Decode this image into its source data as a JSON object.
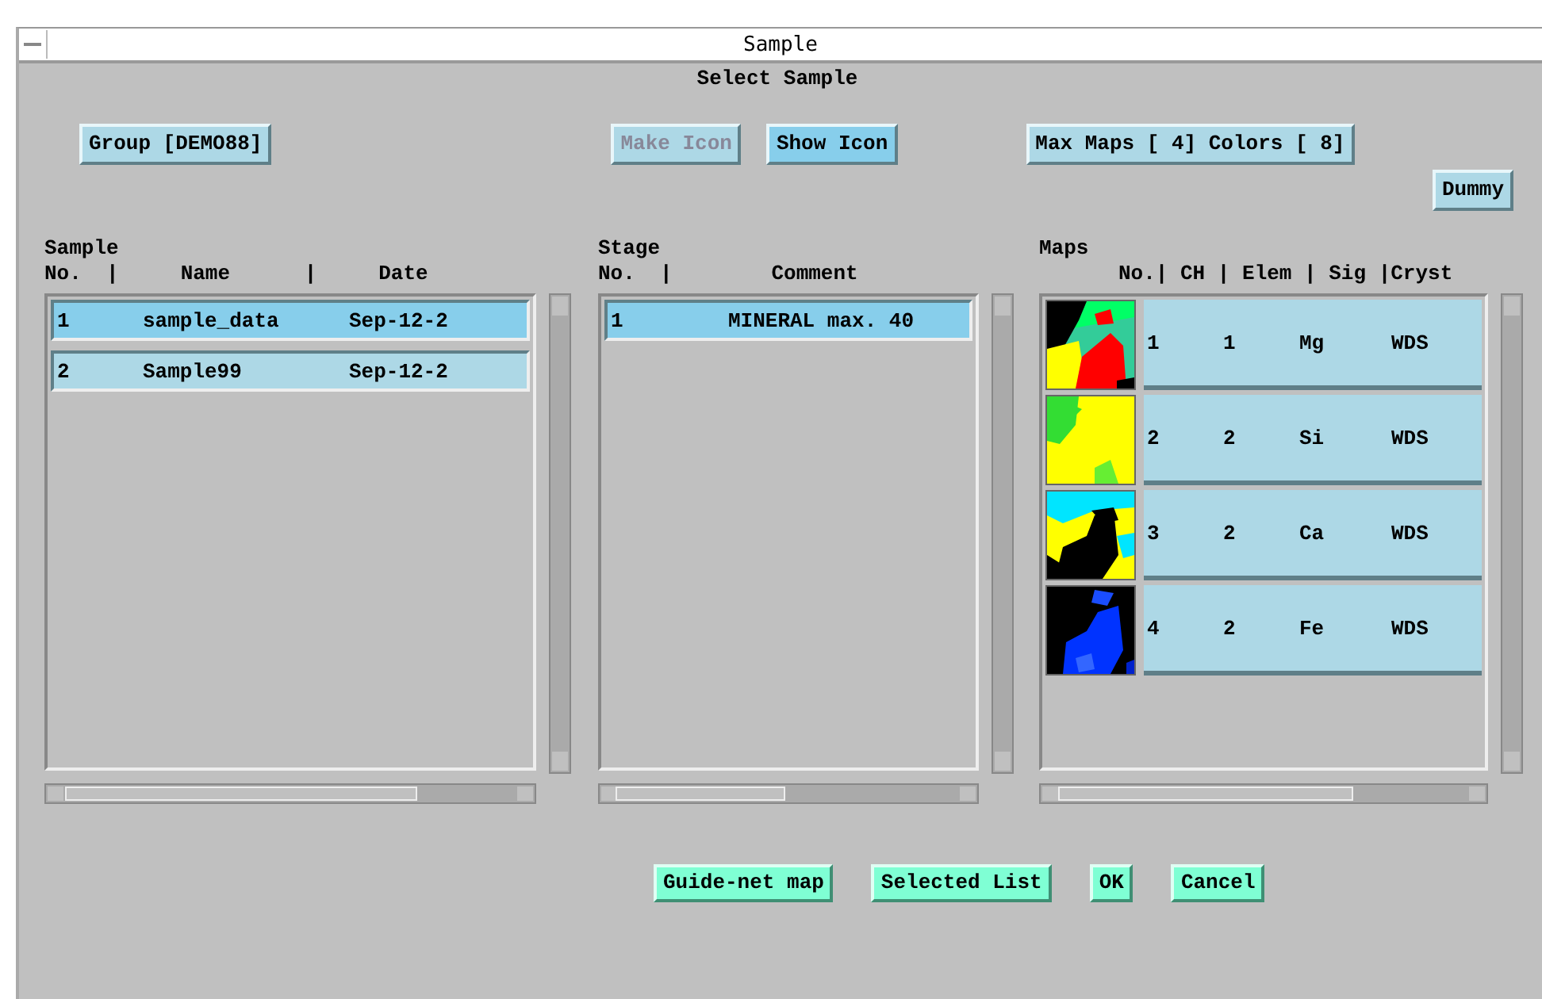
{
  "window": {
    "title": "Sample"
  },
  "heading": "Select Sample",
  "top_buttons": [
    {
      "label": "Group [DEMO88]",
      "disabled": false,
      "active": false
    },
    {
      "label": "Make Icon",
      "disabled": true,
      "active": false
    },
    {
      "label": "Show Icon",
      "disabled": false,
      "active": true
    },
    {
      "label": "Max Maps [ 4] Colors [ 8]",
      "disabled": false,
      "active": false
    }
  ],
  "dummy_button": "Dummy",
  "sample_panel": {
    "title": "Sample",
    "header": "No.  |     Name      |     Date",
    "rows": [
      {
        "no": "1",
        "name": "sample_data",
        "date": "Sep-12-2",
        "selected": true
      },
      {
        "no": "2",
        "name": "Sample99",
        "date": "Sep-12-2",
        "selected": false
      }
    ]
  },
  "stage_panel": {
    "title": "Stage",
    "header": "No.  |        Comment",
    "rows": [
      {
        "no": "1",
        "comment": "MINERAL max. 40",
        "selected": true
      }
    ]
  },
  "maps_panel": {
    "title": "Maps",
    "header": "No.| CH | Elem | Sig |Cryst",
    "rows": [
      {
        "no": "1",
        "ch": "1",
        "elem": "Mg",
        "sig": "WDS",
        "kind": "picture"
      },
      {
        "no": "2",
        "ch": "2",
        "elem": "Si",
        "sig": "WDS",
        "kind": "picture"
      },
      {
        "no": "3",
        "ch": "2",
        "elem": "Ca",
        "sig": "WDS",
        "kind": "picture"
      },
      {
        "no": "4",
        "ch": "2",
        "elem": "Fe",
        "sig": "WDS",
        "kind": "picture"
      }
    ]
  },
  "bottom_buttons": [
    "Guide-net map",
    "Selected List",
    "OK",
    "Cancel"
  ]
}
